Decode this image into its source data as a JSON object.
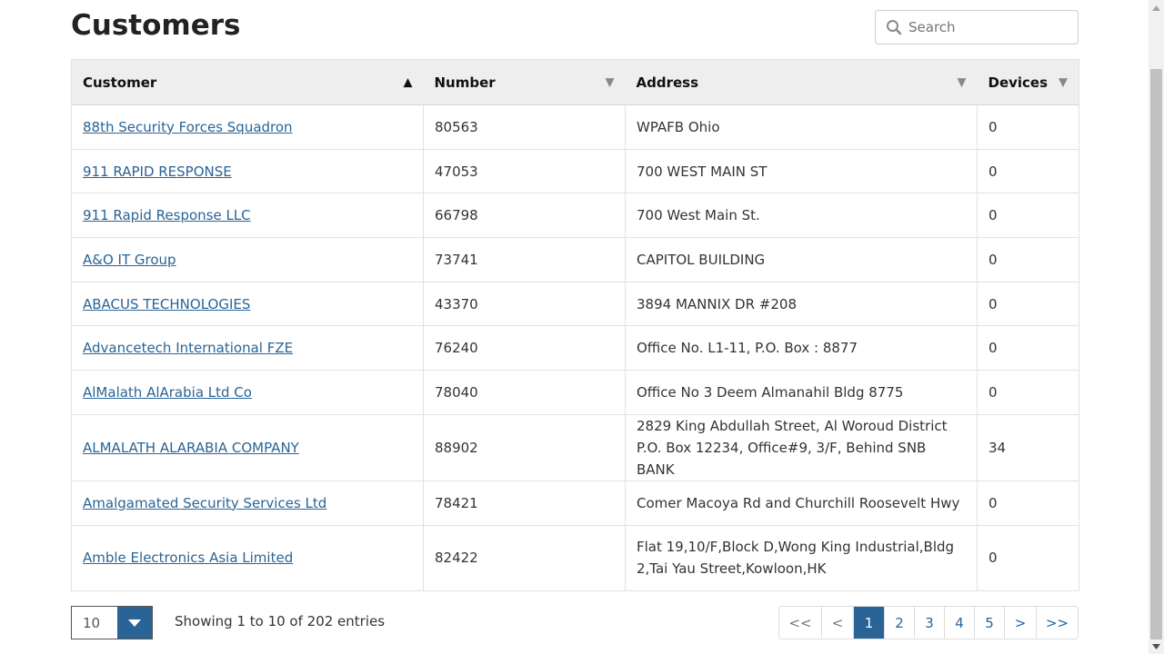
{
  "page": {
    "title": "Customers"
  },
  "search": {
    "placeholder": "Search",
    "icon": "search-icon"
  },
  "table": {
    "columns": [
      {
        "label": "Customer",
        "sort": "asc"
      },
      {
        "label": "Number",
        "sort": "none"
      },
      {
        "label": "Address",
        "sort": "none"
      },
      {
        "label": "Devices",
        "sort": "none"
      }
    ],
    "rows": [
      {
        "customer": "88th Security Forces Squadron",
        "number": "80563",
        "address": "WPAFB Ohio",
        "devices": "0"
      },
      {
        "customer": "911 RAPID RESPONSE",
        "number": "47053",
        "address": "700 WEST MAIN ST",
        "devices": "0"
      },
      {
        "customer": "911 Rapid Response LLC",
        "number": "66798",
        "address": "700 West Main St.",
        "devices": "0"
      },
      {
        "customer": "A&O IT Group",
        "number": "73741",
        "address": "CAPITOL BUILDING",
        "devices": "0"
      },
      {
        "customer": "ABACUS TECHNOLOGIES",
        "number": "43370",
        "address": "3894 MANNIX DR #208",
        "devices": "0"
      },
      {
        "customer": "Advancetech International FZE",
        "number": "76240",
        "address": "Office No. L1-11, P.O. Box : 8877",
        "devices": "0"
      },
      {
        "customer": "AlMalath AlArabia Ltd Co",
        "number": "78040",
        "address": "Office No 3 Deem Almanahil Bldg 8775",
        "devices": "0"
      },
      {
        "customer": "ALMALATH ALARABIA COMPANY",
        "number": "88902",
        "address": "2829 King Abdullah Street, Al Woroud District P.O. Box 12234, Office#9, 3/F, Behind SNB BANK",
        "devices": "34"
      },
      {
        "customer": "Amalgamated Security Services Ltd",
        "number": "78421",
        "address": "Comer Macoya Rd and Churchill Roosevelt Hwy",
        "devices": "0"
      },
      {
        "customer": "Amble Electronics Asia Limited",
        "number": "82422",
        "address": "Flat 19,10/F,Block D,Wong King Industrial,Bldg 2,Tai Yau Street,Kowloon,HK",
        "devices": "0"
      }
    ]
  },
  "footer": {
    "page_length": "10",
    "info": "Showing 1 to 10 of 202 entries",
    "pagination": {
      "first": "<<",
      "prev": "<",
      "pages": [
        "1",
        "2",
        "3",
        "4",
        "5"
      ],
      "current": "1",
      "next": ">",
      "last": ">>"
    }
  },
  "colors": {
    "link": "#2a6496",
    "header_bg": "#eeeeee",
    "accent": "#2a6496"
  }
}
